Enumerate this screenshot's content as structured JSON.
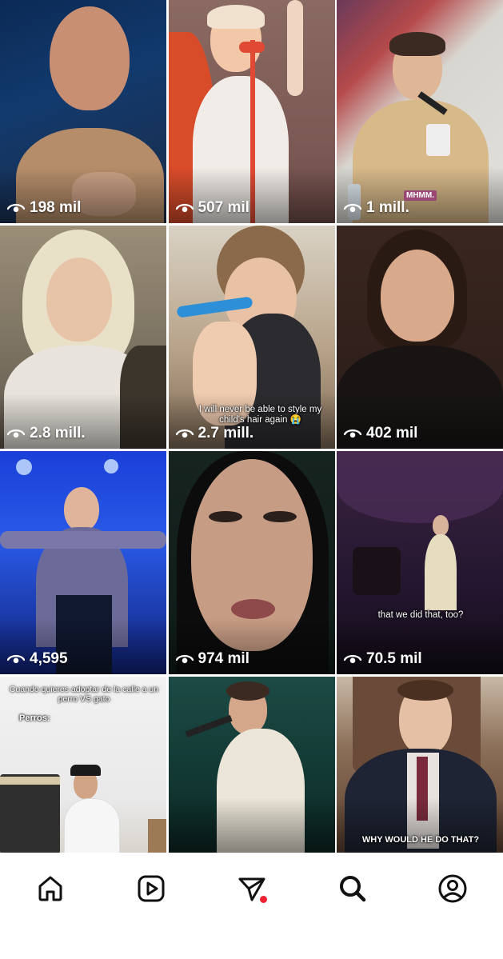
{
  "tiles": [
    {
      "views": "198 mil"
    },
    {
      "views": "507 mil"
    },
    {
      "views": "1 mill.",
      "badge": "MHMM."
    },
    {
      "views": "2.8 mill."
    },
    {
      "views": "2.7 mill.",
      "caption": "I will never be able to style my child's hair again 😭"
    },
    {
      "views": "402 mil"
    },
    {
      "views": "4,595"
    },
    {
      "views": "974 mil"
    },
    {
      "views": "70.5 mil",
      "caption": "that we did that, too?"
    },
    {
      "views": "",
      "caption": "Cuando quieres adoptar de la calle a un perro VS gato",
      "caption2": "Perros:"
    },
    {
      "views": ""
    },
    {
      "views": "",
      "caption": "WHY WOULD HE DO THAT?"
    }
  ],
  "nav": {
    "items": [
      {
        "icon": "home-icon"
      },
      {
        "icon": "reels-icon"
      },
      {
        "icon": "send-icon",
        "notification": true
      },
      {
        "icon": "search-icon",
        "active": true
      },
      {
        "icon": "profile-icon"
      }
    ]
  },
  "colors": {
    "accent_dot": "#ee2233",
    "icon": "#111111"
  }
}
